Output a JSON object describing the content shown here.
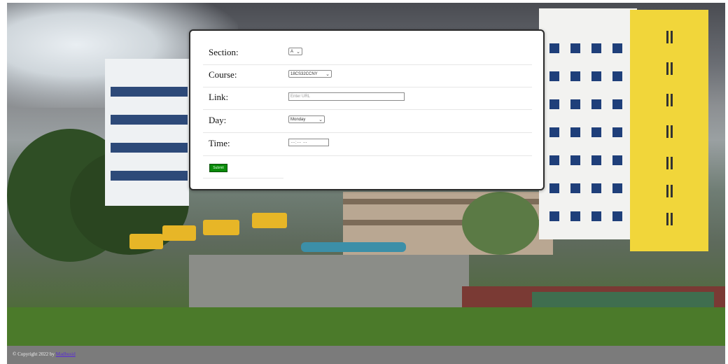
{
  "form": {
    "section": {
      "label": "Section:",
      "value": "A"
    },
    "course": {
      "label": "Course:",
      "value": "18CS32CCNY"
    },
    "link": {
      "label": "Link:",
      "placeholder": "Enter URL"
    },
    "day": {
      "label": "Day:",
      "value": "Monday"
    },
    "time": {
      "label": "Time:",
      "value": "--:-- --"
    },
    "submit_label": "Submit"
  },
  "footer": {
    "copyright": "© Copyright 2022 by",
    "author": "Madhusid"
  },
  "colors": {
    "submit": "#0a8a0a",
    "footer_bg": "#7b7b7b",
    "link": "#5a2bd6"
  }
}
